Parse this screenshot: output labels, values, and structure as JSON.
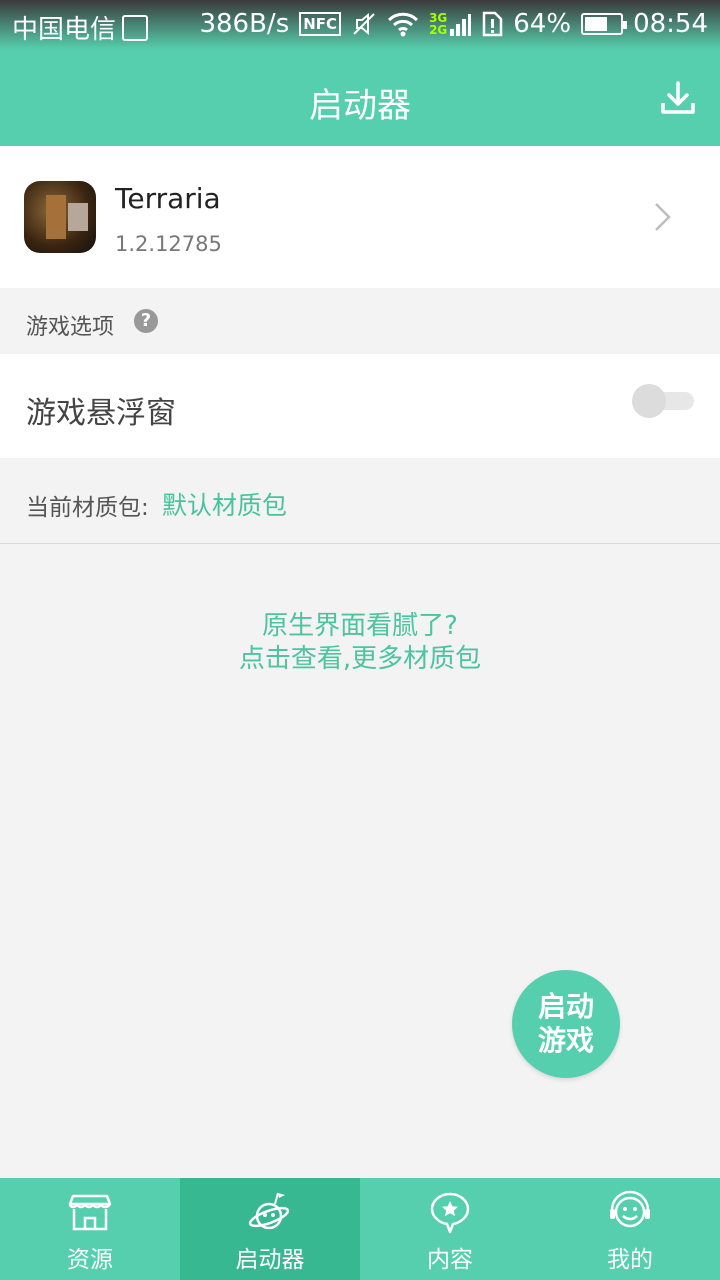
{
  "status_bar": {
    "carrier": "中国电信",
    "speed": "386B/s",
    "nfc": "NFC",
    "network_3g": "3G",
    "network_2g": "2G",
    "battery_percent": "64%",
    "battery_level": 0.64,
    "time": "08:54"
  },
  "app_bar": {
    "title": "启动器",
    "download_icon": "download-icon"
  },
  "game": {
    "name": "Terraria",
    "version": "1.2.12785"
  },
  "options": {
    "section_label": "游戏选项",
    "help_glyph": "?",
    "floating_window_label": "游戏悬浮窗",
    "floating_window_enabled": false
  },
  "texture_pack": {
    "prefix": "当前材质包:",
    "current": "默认材质包"
  },
  "promo": {
    "line1": "原生界面看腻了?",
    "line2": "点击查看,更多材质包"
  },
  "launch_button": {
    "line1": "启动",
    "line2": "游戏"
  },
  "tabs": [
    {
      "label": "资源",
      "icon": "store-icon",
      "active": false
    },
    {
      "label": "启动器",
      "icon": "planet-icon",
      "active": true
    },
    {
      "label": "内容",
      "icon": "chat-star-icon",
      "active": false
    },
    {
      "label": "我的",
      "icon": "smiley-headset-icon",
      "active": false
    }
  ],
  "colors": {
    "primary": "#56cfae",
    "active_tab": "#38b891",
    "accent_text": "#46c39c"
  }
}
